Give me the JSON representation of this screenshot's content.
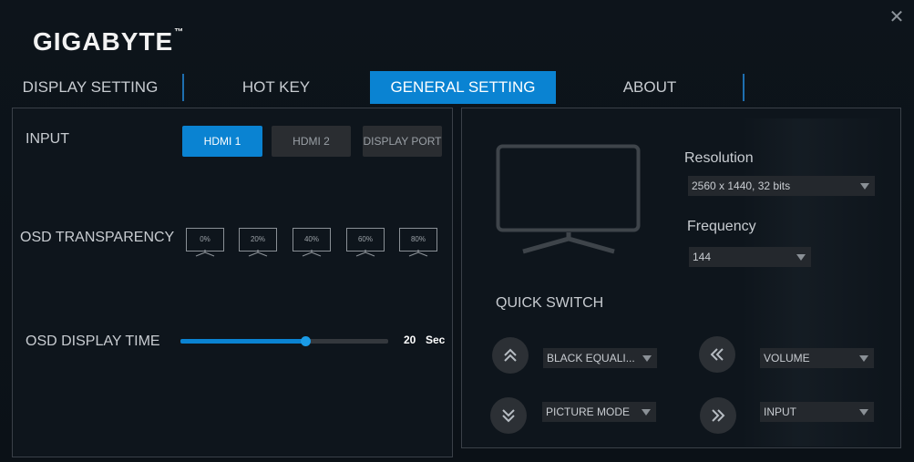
{
  "app": {
    "logo": "GIGABYTE",
    "logo_mark": "™",
    "close_glyph": "✕"
  },
  "tabs": [
    {
      "label": "DISPLAY SETTING",
      "active": false
    },
    {
      "label": "HOT KEY",
      "active": false
    },
    {
      "label": "GENERAL SETTING",
      "active": true
    },
    {
      "label": "ABOUT",
      "active": false
    }
  ],
  "input": {
    "label": "INPUT",
    "options": [
      "HDMI 1",
      "HDMI 2",
      "DISPLAY PORT"
    ],
    "selected": "HDMI 1"
  },
  "osd_transparency": {
    "label": "OSD TRANSPARENCY",
    "options": [
      "0%",
      "20%",
      "40%",
      "60%",
      "80%"
    ]
  },
  "osd_display_time": {
    "label": "OSD DISPLAY TIME",
    "value": "20",
    "unit": "Sec",
    "fraction": 0.6
  },
  "resolution": {
    "label": "Resolution",
    "value": "2560 x 1440, 32 bits"
  },
  "frequency": {
    "label": "Frequency",
    "value": "144"
  },
  "quick_switch": {
    "label": "QUICK SWITCH",
    "up": "BLACK EQUALI...",
    "down": "PICTURE MODE",
    "left": "VOLUME",
    "right": "INPUT"
  },
  "colors": {
    "accent": "#0a83d2",
    "background": "#0c1219",
    "panel_border": "#3a4048"
  }
}
